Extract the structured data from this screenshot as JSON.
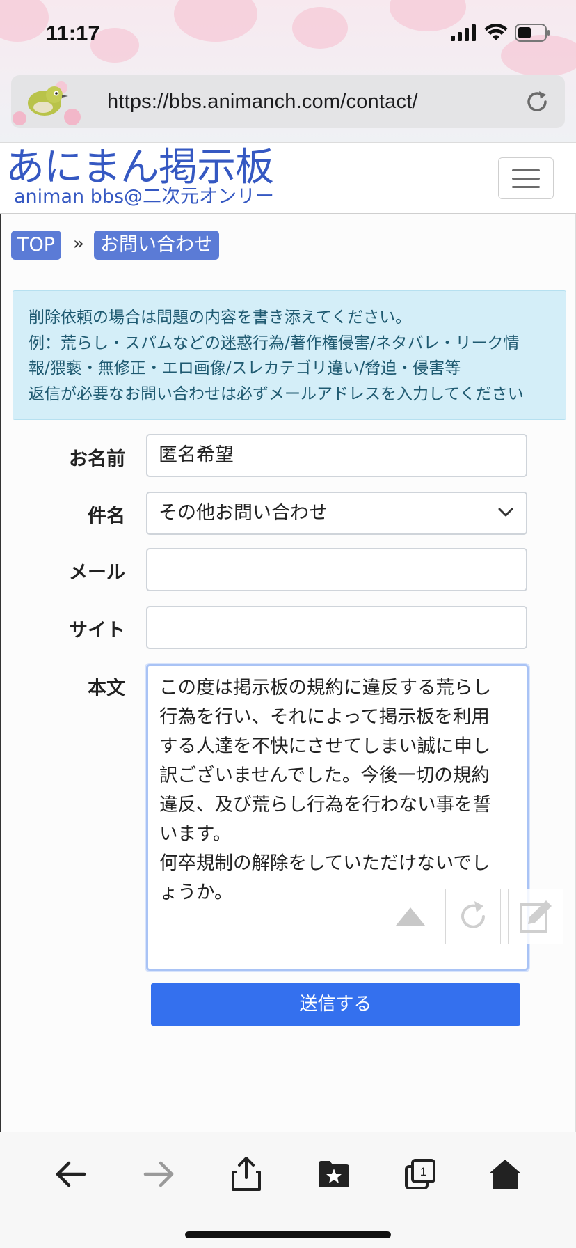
{
  "status_bar": {
    "time": "11:17"
  },
  "browser": {
    "url": "https://bbs.animanch.com/contact/"
  },
  "site": {
    "logo_main": "あにまん掲示板",
    "logo_sub": "animan bbs@二次元オンリー"
  },
  "breadcrumb": {
    "items": [
      "TOP",
      "お問い合わせ"
    ],
    "separator": "»"
  },
  "notice": {
    "lines": [
      "削除依頼の場合は問題の内容を書き添えてください。",
      "例：荒らし・スパムなどの迷惑行為/著作権侵害/ネタバレ・リーク情",
      "報/猥褻・無修正・エロ画像/スレカテゴリ違い/脅迫・侵害等",
      "返信が必要なお問い合わせは必ずメールアドレスを入力してください"
    ]
  },
  "form": {
    "name_label": "お名前",
    "name_value": "匿名希望",
    "subject_label": "件名",
    "subject_value": "その他お問い合わせ",
    "mail_label": "メール",
    "mail_value": "",
    "site_label": "サイト",
    "site_value": "",
    "body_label": "本文",
    "body_value": "この度は掲示板の規約に違反する荒らし\n行為を行い、それによって掲示板を利用\nする人達を不快にさせてしまい誠に申し\n訳ございませんでした。今後一切の規約\n違反、及び荒らし行為を行わない事を誓\nいます。\n何卒規制の解除をしていただけないでし\nょうか。",
    "submit_label": "送信する"
  },
  "toolbar": {
    "tabs_count": "1"
  },
  "colors": {
    "logo": "#3558c2",
    "breadcrumb": "#5b7bd6",
    "alert_bg": "#d4eef8",
    "alert_text": "#1f5a71",
    "submit": "#3470ee"
  }
}
